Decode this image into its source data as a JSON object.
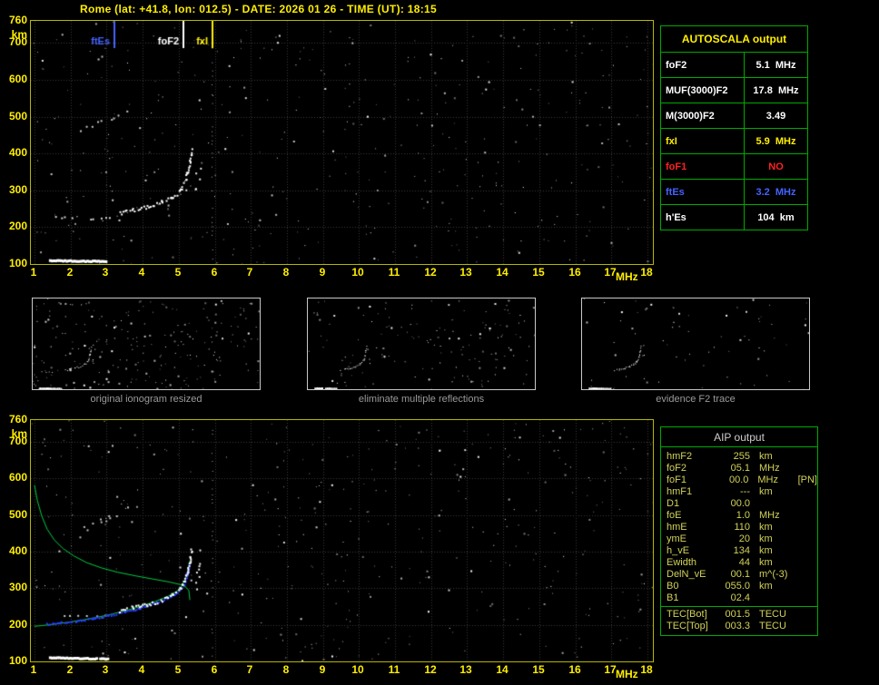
{
  "header": {
    "title": "Rome (lat: +41.8, lon: 012.5) - DATE: 2026 01 26 - TIME (UT): 18:15"
  },
  "autoscala": {
    "title": "AUTOSCALA output",
    "rows": [
      {
        "label": "foF2",
        "value": "5.1",
        "unit": "MHz",
        "color": "#ffffff"
      },
      {
        "label": "MUF(3000)F2",
        "value": "17.8",
        "unit": "MHz",
        "color": "#ffffff"
      },
      {
        "label": "M(3000)F2",
        "value": "3.49",
        "unit": "",
        "color": "#ffffff"
      },
      {
        "label": "fxI",
        "value": "5.9",
        "unit": "MHz",
        "color": "#ffee00"
      },
      {
        "label": "foF1",
        "value": "NO",
        "unit": "",
        "color": "#ff2222"
      },
      {
        "label": "ftEs",
        "value": "3.2",
        "unit": "MHz",
        "color": "#4463ff"
      },
      {
        "label": "h'Es",
        "value": "104",
        "unit": "km",
        "color": "#ffffff"
      }
    ]
  },
  "thumbnails": [
    {
      "caption": "original ionogram resized"
    },
    {
      "caption": "eliminate multiple reflections"
    },
    {
      "caption": "evidence F2 trace"
    }
  ],
  "aip": {
    "title": "AIP output",
    "rows": [
      {
        "label": "hmF2",
        "value": "255",
        "unit": "km",
        "note": ""
      },
      {
        "label": "foF2",
        "value": "05.1",
        "unit": "MHz",
        "note": ""
      },
      {
        "label": "foF1",
        "value": "00.0",
        "unit": "MHz",
        "note": "[PN]"
      },
      {
        "label": "hmF1",
        "value": "---",
        "unit": "km",
        "note": ""
      },
      {
        "label": "D1",
        "value": "00.0",
        "unit": "",
        "note": ""
      },
      {
        "label": "foE",
        "value": "1.0",
        "unit": "MHz",
        "note": ""
      },
      {
        "label": "hmE",
        "value": "110",
        "unit": "km",
        "note": ""
      },
      {
        "label": "ymE",
        "value": "20",
        "unit": "km",
        "note": ""
      },
      {
        "label": "h_vE",
        "value": "134",
        "unit": "km",
        "note": ""
      },
      {
        "label": "Ewidth",
        "value": "44",
        "unit": "km",
        "note": ""
      },
      {
        "label": "DelN_vE",
        "value": "00.1",
        "unit": "m^(-3)",
        "note": ""
      },
      {
        "label": "B0",
        "value": "055.0",
        "unit": "km",
        "note": ""
      },
      {
        "label": "B1",
        "value": "02.4",
        "unit": "",
        "note": ""
      }
    ],
    "tec_rows": [
      {
        "label": "TEC[Bot]",
        "value": "001.5",
        "unit": "TECU",
        "note": ""
      },
      {
        "label": "TEC[Top]",
        "value": "003.3",
        "unit": "TECU",
        "note": ""
      }
    ]
  },
  "chart_data": [
    {
      "id": "ionogram_top",
      "type": "scatter",
      "title": "Autoscaled ionogram",
      "xlabel": "MHz",
      "ylabel": "km",
      "xlim": [
        0.9,
        18.15
      ],
      "ylim": [
        100,
        760
      ],
      "xticks": [
        1,
        2,
        3,
        4,
        5,
        6,
        7,
        8,
        9,
        10,
        11,
        12,
        13,
        14,
        15,
        16,
        17,
        18
      ],
      "yticks": [
        760,
        700,
        600,
        500,
        400,
        300,
        200,
        100
      ],
      "grid": true,
      "legend": "none",
      "noise": {
        "count": 430,
        "seed": 11
      },
      "markers": [
        {
          "label": "ftEs",
          "freq": 3.2,
          "color": "#4463ff"
        },
        {
          "label": "foF2",
          "freq": 5.1,
          "color": "#ffffff"
        },
        {
          "label": "fxI",
          "freq": 5.9,
          "color": "#ffee00"
        }
      ],
      "traces": [
        {
          "name": "multiple-reflection",
          "style": "dots",
          "color": "#c8c8c8",
          "size": 2,
          "gap": 3,
          "density": 0.55,
          "jx": 5,
          "jy": 7,
          "seed": 25,
          "points": [
            [
              1.95,
              450
            ],
            [
              2.4,
              464
            ],
            [
              2.85,
              486
            ],
            [
              3.2,
              500
            ],
            [
              3.6,
              518
            ]
          ]
        },
        {
          "name": "Es-second-hop",
          "style": "dots",
          "color": "#d8d8d8",
          "size": 2,
          "gap": 4,
          "density": 0.45,
          "jx": 3,
          "jy": 3,
          "seed": 22,
          "points": [
            [
              1.6,
              229
            ],
            [
              2.4,
              226
            ],
            [
              3.3,
              224
            ]
          ]
        },
        {
          "name": "Es-trace",
          "style": "dots",
          "color": "#ffffff",
          "size": 3,
          "gap": 2,
          "density": 0.97,
          "jx": 0,
          "jy": 1,
          "seed": 21,
          "points": [
            [
              1.4,
              113
            ],
            [
              3.0,
              110
            ]
          ]
        },
        {
          "name": "F2-trace",
          "style": "dots",
          "color": "#ffffff",
          "size": 2,
          "gap": 2,
          "density": 0.93,
          "jx": 2,
          "jy": 4,
          "seed": 23,
          "points": [
            [
              3.35,
              240
            ],
            [
              3.7,
              248
            ],
            [
              4.1,
              257
            ],
            [
              4.5,
              268
            ],
            [
              4.8,
              283
            ],
            [
              5.0,
              299
            ],
            [
              5.12,
              318
            ],
            [
              5.22,
              345
            ],
            [
              5.3,
              380
            ],
            [
              5.35,
              412
            ]
          ]
        },
        {
          "name": "F2-spread",
          "style": "dots",
          "color": "#eeeeee",
          "size": 2,
          "gap": 3,
          "density": 0.5,
          "jx": 6,
          "jy": 7,
          "seed": 24,
          "points": [
            [
              5.5,
              300
            ],
            [
              5.55,
              420
            ]
          ]
        },
        {
          "name": "x-trace-asymptote",
          "style": "dots",
          "color": "#aaaaaa",
          "size": 1,
          "gap": 5,
          "density": 0.5,
          "jx": 1,
          "jy": 2,
          "seed": 26,
          "points": [
            [
              5.92,
              735
            ],
            [
              5.92,
              115
            ]
          ]
        }
      ]
    },
    {
      "id": "ionogram_bottom",
      "type": "scatter",
      "title": "Restored trace and electron density profile",
      "xlabel": "MHz",
      "ylabel": "km",
      "xlim": [
        0.9,
        18.15
      ],
      "ylim": [
        100,
        760
      ],
      "xticks": [
        1,
        2,
        3,
        4,
        5,
        6,
        7,
        8,
        9,
        10,
        11,
        12,
        13,
        14,
        15,
        16,
        17,
        18
      ],
      "yticks": [
        760,
        700,
        600,
        500,
        400,
        300,
        200,
        100
      ],
      "grid": true,
      "legend": "none",
      "noise": {
        "count": 430,
        "seed": 12
      },
      "markers": [],
      "traces": [
        {
          "name": "multiple-reflection",
          "style": "dots",
          "color": "#c0c0c0",
          "size": 2,
          "gap": 3,
          "density": 0.5,
          "jx": 5,
          "jy": 7,
          "seed": 35,
          "points": [
            [
              1.95,
              450
            ],
            [
              2.4,
              464
            ],
            [
              2.85,
              486
            ],
            [
              3.2,
              500
            ],
            [
              3.6,
              518
            ]
          ]
        },
        {
          "name": "Es-second-hop",
          "style": "dots",
          "color": "#cccccc",
          "size": 2,
          "gap": 4,
          "density": 0.3,
          "jx": 3,
          "jy": 3,
          "seed": 32,
          "points": [
            [
              1.6,
              229
            ],
            [
              2.4,
              226
            ],
            [
              3.3,
              224
            ]
          ]
        },
        {
          "name": "profile-topside",
          "style": "line",
          "color": "#00cc44",
          "width": 1,
          "points": [
            [
              1.0,
              582
            ],
            [
              1.08,
              540
            ],
            [
              1.2,
              498
            ],
            [
              1.35,
              462
            ],
            [
              1.55,
              432
            ],
            [
              1.8,
              408
            ],
            [
              2.1,
              388
            ],
            [
              2.45,
              370
            ],
            [
              2.85,
              356
            ],
            [
              3.3,
              344
            ],
            [
              3.8,
              334
            ],
            [
              4.3,
              325
            ],
            [
              4.75,
              317
            ],
            [
              5.05,
              310
            ],
            [
              5.2,
              303
            ],
            [
              5.28,
              294
            ],
            [
              5.31,
              268
            ]
          ]
        },
        {
          "name": "profile-bottomside",
          "style": "line",
          "color": "#00cc44",
          "width": 1,
          "points": [
            [
              1.0,
              196
            ],
            [
              1.5,
              201
            ],
            [
              2.0,
              208
            ],
            [
              2.5,
              216
            ],
            [
              3.0,
              226
            ],
            [
              3.5,
              238
            ],
            [
              3.95,
              251
            ],
            [
              4.35,
              264
            ],
            [
              4.7,
              278
            ],
            [
              4.95,
              292
            ],
            [
              5.1,
              308
            ],
            [
              5.2,
              328
            ],
            [
              5.27,
              352
            ],
            [
              5.3,
              374
            ]
          ]
        },
        {
          "name": "restored-trace",
          "style": "dots",
          "color": "#2b3cff",
          "size": 2,
          "gap": 2,
          "density": 0.95,
          "jx": 2,
          "jy": 2,
          "seed": 33,
          "points": [
            [
              1.25,
              203
            ],
            [
              1.7,
              207
            ],
            [
              2.15,
              212
            ],
            [
              2.6,
              219
            ],
            [
              3.05,
              227
            ],
            [
              3.5,
              237
            ],
            [
              3.9,
              248
            ],
            [
              4.3,
              260
            ],
            [
              4.65,
              273
            ],
            [
              4.9,
              287
            ],
            [
              5.05,
              300
            ],
            [
              5.15,
              318
            ],
            [
              5.22,
              342
            ],
            [
              5.27,
              365
            ]
          ]
        },
        {
          "name": "Es-trace",
          "style": "dots",
          "color": "#ffffff",
          "size": 3,
          "gap": 2,
          "density": 0.97,
          "jx": 0,
          "jy": 1,
          "seed": 31,
          "points": [
            [
              1.4,
              113
            ],
            [
              3.0,
              110
            ]
          ]
        },
        {
          "name": "F2-trace",
          "style": "dots",
          "color": "#ffffff",
          "size": 2,
          "gap": 2,
          "density": 0.93,
          "jx": 2,
          "jy": 4,
          "seed": 34,
          "points": [
            [
              3.35,
              240
            ],
            [
              3.7,
              248
            ],
            [
              4.1,
              257
            ],
            [
              4.5,
              268
            ],
            [
              4.8,
              283
            ],
            [
              5.0,
              299
            ],
            [
              5.12,
              318
            ],
            [
              5.22,
              345
            ],
            [
              5.3,
              380
            ],
            [
              5.35,
              412
            ]
          ]
        },
        {
          "name": "F2-spread",
          "style": "dots",
          "color": "#eeeeee",
          "size": 2,
          "gap": 3,
          "density": 0.5,
          "jx": 6,
          "jy": 7,
          "seed": 36,
          "points": [
            [
              5.5,
              300
            ],
            [
              5.55,
              420
            ]
          ]
        },
        {
          "name": "x-trace-asymptote",
          "style": "dots",
          "color": "#aaaaaa",
          "size": 1,
          "gap": 5,
          "density": 0.5,
          "jx": 1,
          "jy": 2,
          "seed": 37,
          "points": [
            [
              5.92,
              735
            ],
            [
              5.92,
              115
            ]
          ]
        }
      ]
    },
    {
      "id": "processing_thumbnails",
      "type": "scatter",
      "source": 0,
      "variants": [
        {
          "caption": "original ionogram resized",
          "noise": 240,
          "seed": 41,
          "traces": [
            "Es-trace",
            "Es-second-hop",
            "F2-trace",
            "F2-spread",
            "multiple-reflection"
          ]
        },
        {
          "caption": "eliminate multiple reflections",
          "noise": 150,
          "seed": 42,
          "traces": [
            "Es-trace",
            "F2-trace",
            "F2-spread"
          ]
        },
        {
          "caption": "evidence F2 trace",
          "noise": 70,
          "seed": 43,
          "traces": [
            "Es-trace",
            "F2-trace",
            "F2-spread"
          ]
        }
      ]
    }
  ]
}
